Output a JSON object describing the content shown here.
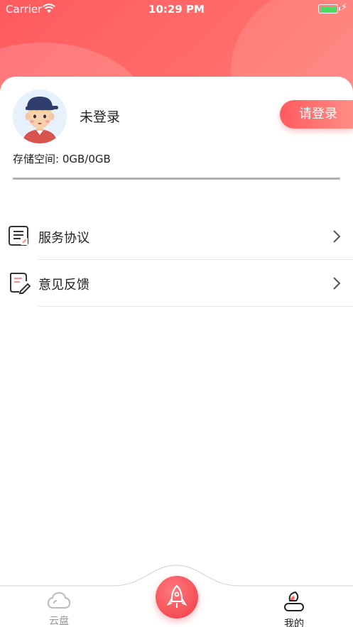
{
  "status_bar": {
    "carrier": "Carrier",
    "time": "10:29 PM"
  },
  "profile": {
    "name": "未登录",
    "login_button": "请登录",
    "storage_text": "存储空间: 0GB/0GB",
    "storage_used_fraction": 0
  },
  "menu": [
    {
      "label": "服务协议",
      "icon": "document-icon"
    },
    {
      "label": "意见反馈",
      "icon": "feedback-icon"
    }
  ],
  "tab_bar": {
    "tabs": [
      {
        "label": "云盘",
        "icon": "cloud-icon",
        "active": false
      },
      {
        "label": "我的",
        "icon": "profile-icon",
        "active": true
      }
    ],
    "center_icon": "rocket-icon"
  },
  "colors": {
    "accent": "#ff5a5f",
    "text": "#222222",
    "inactive": "#999999"
  }
}
